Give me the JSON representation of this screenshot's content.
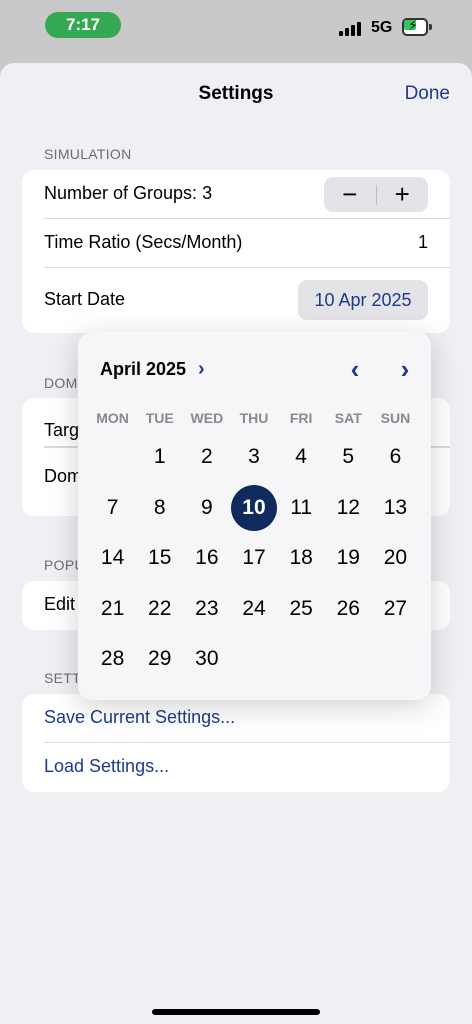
{
  "status": {
    "time": "7:17",
    "network": "5G"
  },
  "nav": {
    "title": "Settings",
    "done_label": "Done"
  },
  "simulation": {
    "header": "SIMULATION",
    "groups_label": "Number of Groups: 3",
    "minus": "−",
    "plus": "+",
    "time_ratio_label": "Time Ratio (Secs/Month)",
    "time_ratio_value": "1",
    "start_date_label": "Start Date",
    "start_date_value": "10 Apr 2025"
  },
  "hidden_section": {
    "header_partial": "DOM",
    "row1_partial": "Targ",
    "row2_partial": "Dom"
  },
  "population": {
    "header_partial": "POPU",
    "row_partial": "Edit"
  },
  "settings_section": {
    "header_partial": "SETT",
    "save_label": "Save Current Settings...",
    "load_label": "Load Settings..."
  },
  "calendar": {
    "month_label": "April 2025",
    "month_chevron": "›",
    "prev": "‹",
    "next": "›",
    "weekdays": [
      "MON",
      "TUE",
      "WED",
      "THU",
      "FRI",
      "SAT",
      "SUN"
    ],
    "days": [
      "",
      "1",
      "2",
      "3",
      "4",
      "5",
      "6",
      "7",
      "8",
      "9",
      "10",
      "11",
      "12",
      "13",
      "14",
      "15",
      "16",
      "17",
      "18",
      "19",
      "20",
      "21",
      "22",
      "23",
      "24",
      "25",
      "26",
      "27",
      "28",
      "29",
      "30",
      "",
      "",
      "",
      ""
    ],
    "selected": "10"
  },
  "colors": {
    "accent": "#1f3a8a",
    "selected": "#102a5e",
    "time_pill": "#34a853"
  }
}
